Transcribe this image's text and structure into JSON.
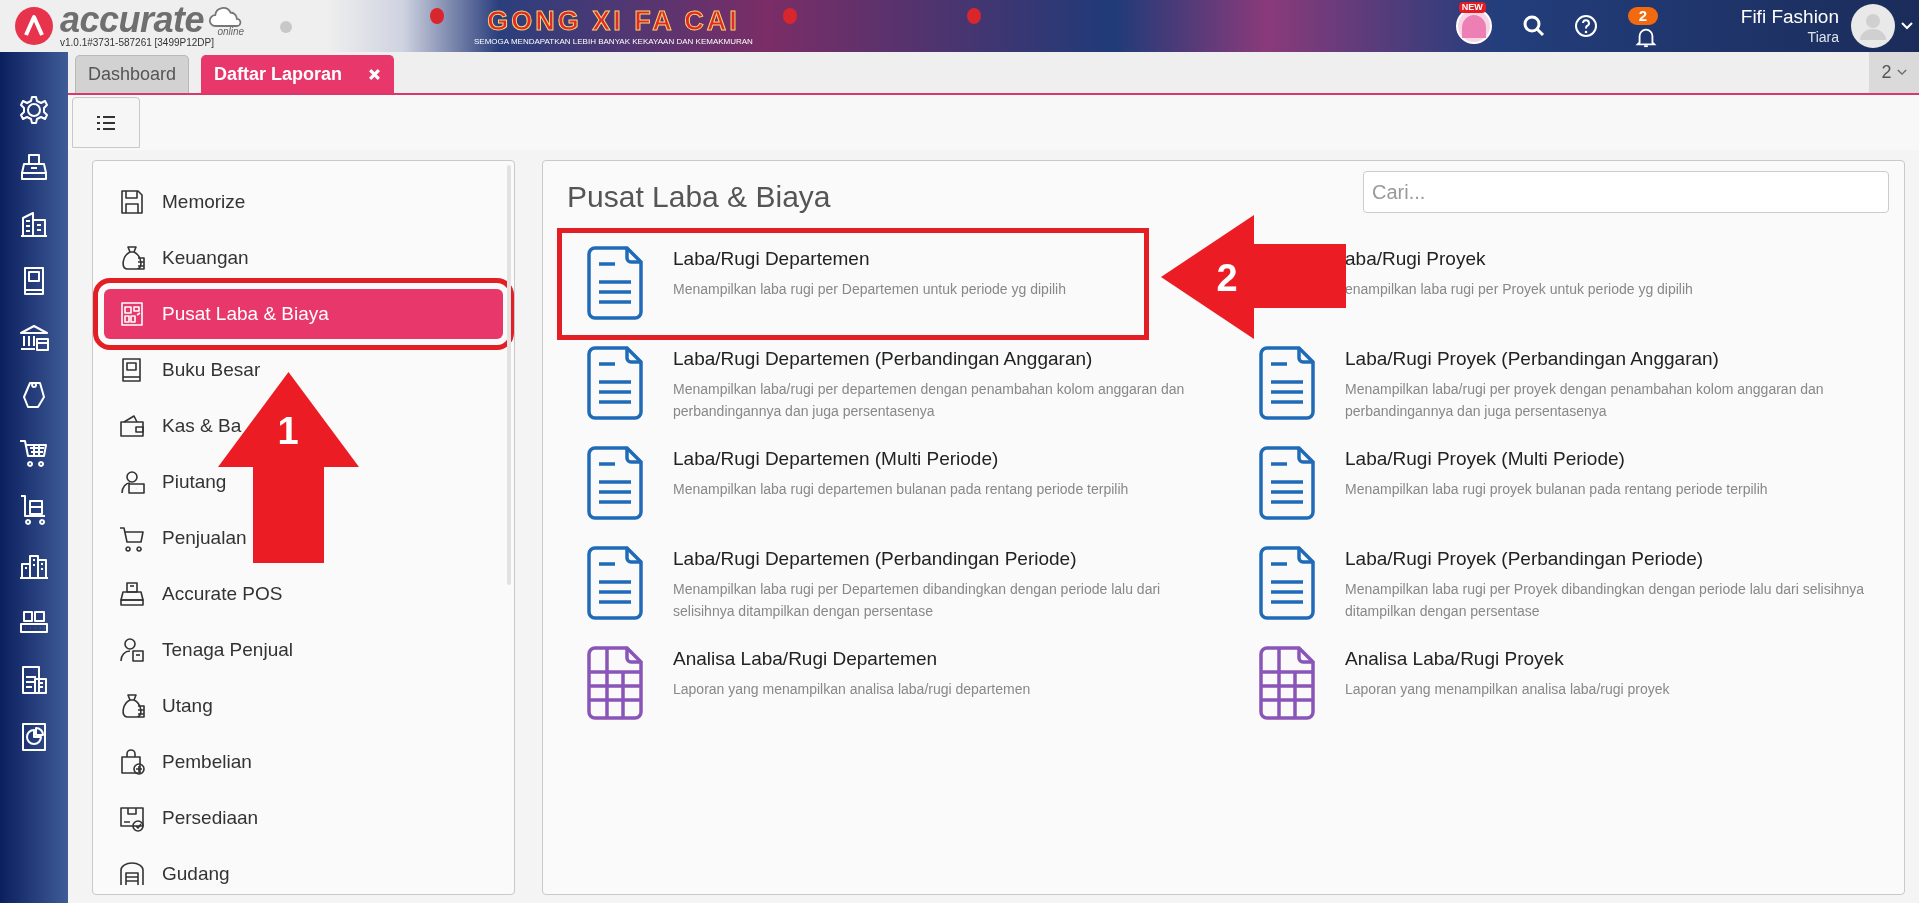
{
  "header": {
    "logo_text": "accurate",
    "logo_sub": "online",
    "version": "v1.0.1#3731-587261 [3499P12DP]",
    "banner_title": "GONG XI FA CAI",
    "banner_subtitle": "SEMOGA MENDAPATKAN LEBIH BANYAK KEKAYAAN DAN KEMAKMURAN",
    "new_badge": "NEW",
    "notification_count": "2",
    "user_name": "Fifi Fashion",
    "user_role": "Tiara"
  },
  "tabs": [
    {
      "label": "Dashboard",
      "selected": false,
      "closable": false
    },
    {
      "label": "Daftar Laporan",
      "selected": true,
      "closable": true
    }
  ],
  "tab_overflow": "2",
  "menu": {
    "items": [
      {
        "label": "Memorize",
        "kind": "save",
        "selected": false,
        "annotated": false
      },
      {
        "label": "Keuangan",
        "kind": "moneybag",
        "selected": false,
        "annotated": false
      },
      {
        "label": "Pusat Laba & Biaya",
        "kind": "board",
        "selected": true,
        "annotated": true
      },
      {
        "label": "Buku Besar",
        "kind": "book",
        "selected": false,
        "annotated": false
      },
      {
        "label": "Kas & Ba",
        "kind": "wallet",
        "selected": false,
        "annotated": false
      },
      {
        "label": "Piutang",
        "kind": "person-money",
        "selected": false,
        "annotated": false
      },
      {
        "label": "Penjualan",
        "kind": "cart",
        "selected": false,
        "annotated": false
      },
      {
        "label": "Accurate POS",
        "kind": "register",
        "selected": false,
        "annotated": false
      },
      {
        "label": "Tenaga Penjual",
        "kind": "person-badge",
        "selected": false,
        "annotated": false
      },
      {
        "label": "Utang",
        "kind": "moneybag",
        "selected": false,
        "annotated": false
      },
      {
        "label": "Pembelian",
        "kind": "bag",
        "selected": false,
        "annotated": false
      },
      {
        "label": "Persediaan",
        "kind": "box",
        "selected": false,
        "annotated": false
      },
      {
        "label": "Gudang",
        "kind": "warehouse",
        "selected": false,
        "annotated": false
      }
    ]
  },
  "report": {
    "title": "Pusat Laba & Biaya",
    "search": {
      "placeholder": "Cari..."
    },
    "columns": [
      [
        {
          "title": "Laba/Rugi Departemen",
          "description": "Menampilkan laba rugi per Departemen untuk periode yg dipilih",
          "kind": "document",
          "annotated": true
        },
        {
          "title": "Laba/Rugi Departemen (Perbandingan Anggaran)",
          "description": "Menampilkan laba/rugi per departemen dengan penambahan kolom anggaran dan perbandingannya dan juga persentasenya",
          "kind": "document",
          "annotated": false
        },
        {
          "title": "Laba/Rugi Departemen (Multi Periode)",
          "description": "Menampilkan laba rugi departemen bulanan pada rentang periode terpilih",
          "kind": "document",
          "annotated": false
        },
        {
          "title": "Laba/Rugi Departemen (Perbandingan Periode)",
          "description": "Menampilkan laba rugi per Departemen dibandingkan dengan periode lalu dari selisihnya ditampilkan dengan persentase",
          "kind": "document",
          "annotated": false
        },
        {
          "title": "Analisa Laba/Rugi Departemen",
          "description": "Laporan yang menampilkan analisa laba/rugi departemen",
          "kind": "table",
          "annotated": false
        }
      ],
      [
        {
          "title": "aba/Rugi Proyek",
          "description": "enampilkan laba rugi per Proyek untuk periode yg dipilih",
          "annotated": false
        },
        {
          "title": "Laba/Rugi Proyek (Perbandingan Anggaran)",
          "description": "Menampilkan laba/rugi per proyek dengan penambahan kolom anggaran dan perbandingannya dan juga persentasenya",
          "kind": "document",
          "annotated": false
        },
        {
          "title": "Laba/Rugi Proyek (Multi Periode)",
          "description": "Menampilkan laba rugi proyek bulanan pada rentang periode terpilih",
          "kind": "document",
          "annotated": false
        },
        {
          "title": "Laba/Rugi Proyek (Perbandingan Periode)",
          "description": "Menampilkan laba rugi per Proyek dibandingkan dengan periode lalu dari selisihnya ditampilkan dengan persentase",
          "kind": "document",
          "annotated": false
        },
        {
          "title": "Analisa Laba/Rugi Proyek",
          "description": "Laporan yang menampilkan analisa laba/rugi proyek",
          "kind": "table",
          "annotated": false
        }
      ]
    ]
  },
  "annotations": [
    {
      "label": "1",
      "kind": "up"
    },
    {
      "label": "2",
      "kind": "left"
    }
  ]
}
